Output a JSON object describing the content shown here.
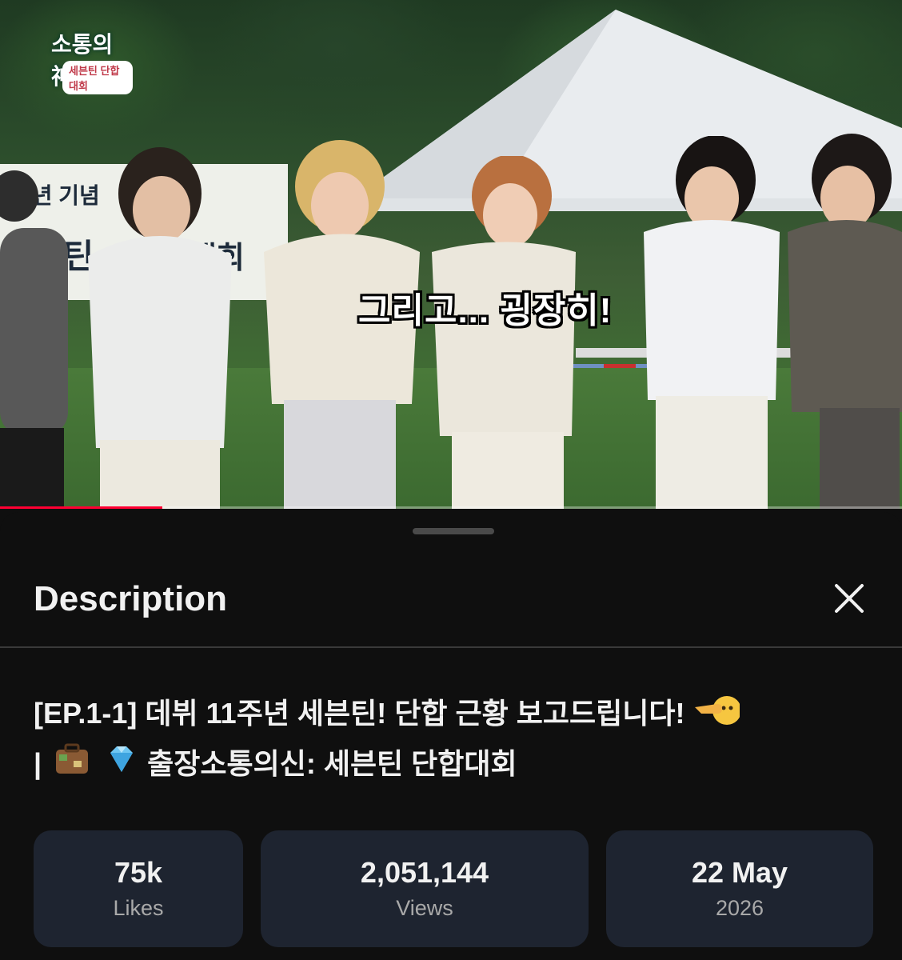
{
  "video": {
    "channel_logo_text": "소통의神",
    "channel_logo_sub": "세븐틴 단합대회",
    "banner_line1": "주년 기념",
    "banner_line2": "븐틴",
    "banner_line3": "대회",
    "subtitle": "그리고... 굉장히!",
    "progress": 0.18
  },
  "sheet": {
    "title": "Description",
    "close_label": "Close"
  },
  "video_title": {
    "line1": "[EP.1-1] 데뷔 11주년 세븐틴! 단합 근황 보고드립니다!",
    "line2_prefix": "| ",
    "line2": "출장소통의신: 세븐틴 단합대회",
    "emoji1": "pointing-hand-emoji",
    "emoji2": "suitcase-emoji",
    "emoji3": "gem-emoji"
  },
  "stats": [
    {
      "value": "75k",
      "label": "Likes"
    },
    {
      "value": "2,051,144",
      "label": "Views"
    },
    {
      "value": "22 May",
      "label": "2026"
    }
  ],
  "colors": {
    "background": "#0f0f0f",
    "card": "#1e2430",
    "progress": "#ff0033"
  }
}
